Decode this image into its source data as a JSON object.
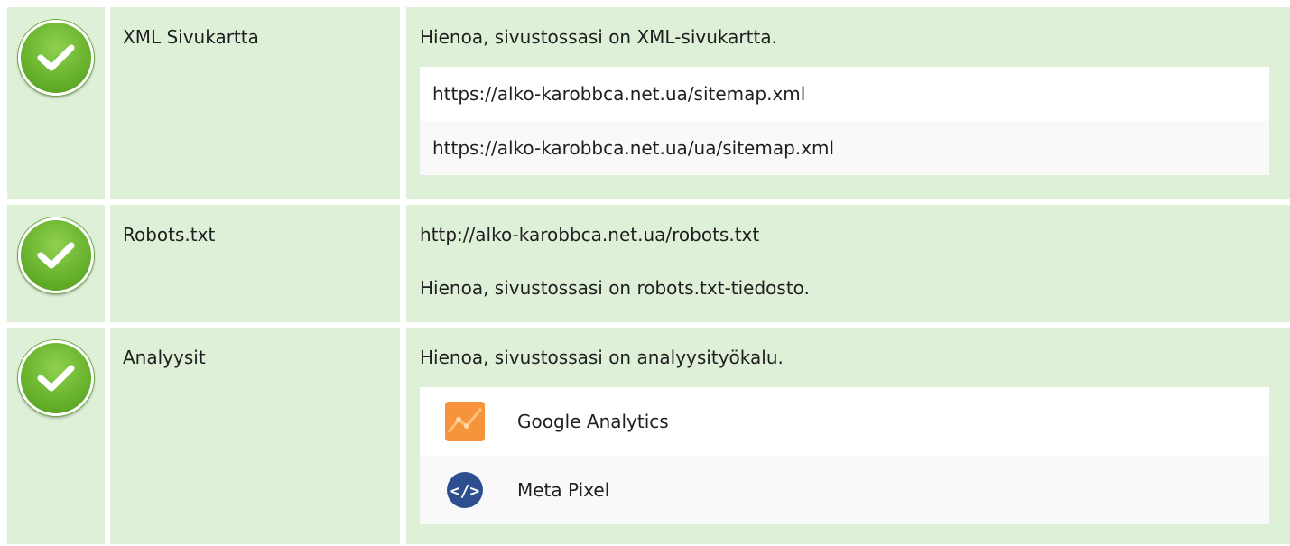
{
  "rows": [
    {
      "label": "XML Sivukartta",
      "message": "Hienoa, sivustossasi on XML-sivukartta.",
      "sitemaps": [
        "https://alko-karobbca.net.ua/sitemap.xml",
        "https://alko-karobbca.net.ua/ua/sitemap.xml"
      ]
    },
    {
      "label": "Robots.txt",
      "url": "http://alko-karobbca.net.ua/robots.txt",
      "message": "Hienoa, sivustossasi on robots.txt-tiedosto."
    },
    {
      "label": "Analyysit",
      "message": "Hienoa, sivustossasi on analyysityökalu.",
      "tools": [
        {
          "name": "Google Analytics",
          "icon": "google-analytics-icon"
        },
        {
          "name": "Meta Pixel",
          "icon": "meta-pixel-icon"
        }
      ]
    }
  ],
  "colors": {
    "row_bg": "#dff0d8",
    "check_green": "#6ab42f",
    "ga_orange": "#f9ab00",
    "meta_blue": "#2d4f8f"
  }
}
